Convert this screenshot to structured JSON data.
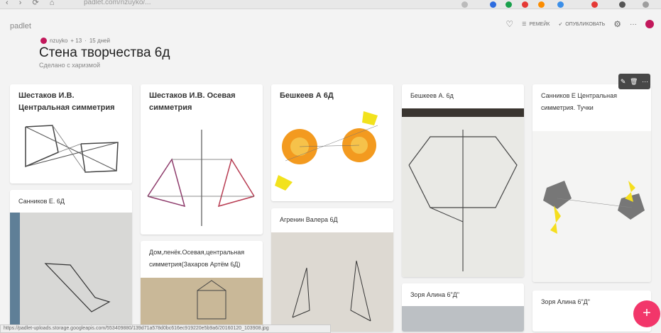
{
  "browser": {
    "nav_icons": "‹ › ⟳ ⌂",
    "url": "padlet.com/nzuyko/..."
  },
  "header": {
    "brand": "padlet",
    "author": "nzuyko",
    "plus_count": "+ 13",
    "age": "15 дней",
    "title": "Стена творчества 6д",
    "subtitle": "Сделано с харизмой"
  },
  "toolbar": {
    "remake": "РЕМЕЙК",
    "publish": "ОПУБЛИКОВАТЬ",
    "more": "···"
  },
  "cards": [
    {
      "title": "Шестаков И.В. Центральная симметрия"
    },
    {
      "title": "Санников Е. 6Д"
    },
    {
      "title": "Шестаков И.В. Осевая симметрия"
    },
    {
      "title": "Дом,ленёк.Осевая,центральная симметрия(Захаров Артём 6Д)"
    },
    {
      "title": "Бешкеев А 6Д"
    },
    {
      "title": "Агренин Валера 6Д"
    },
    {
      "title": "Бешкеев А. 6д"
    },
    {
      "title": "Зоря Алина 6\"Д\""
    },
    {
      "title": "Санников Е Центральная симметрия. Тучки"
    },
    {
      "title": "Зоря Алина 6\"Д\""
    }
  ],
  "statusbar": {
    "url": "https://padlet-uploads.storage.googleapis.com/553409880/139d71a578d0bc616ec919220e5b9a6/20160120_103908.jpg"
  },
  "fab": {
    "label": "+"
  }
}
